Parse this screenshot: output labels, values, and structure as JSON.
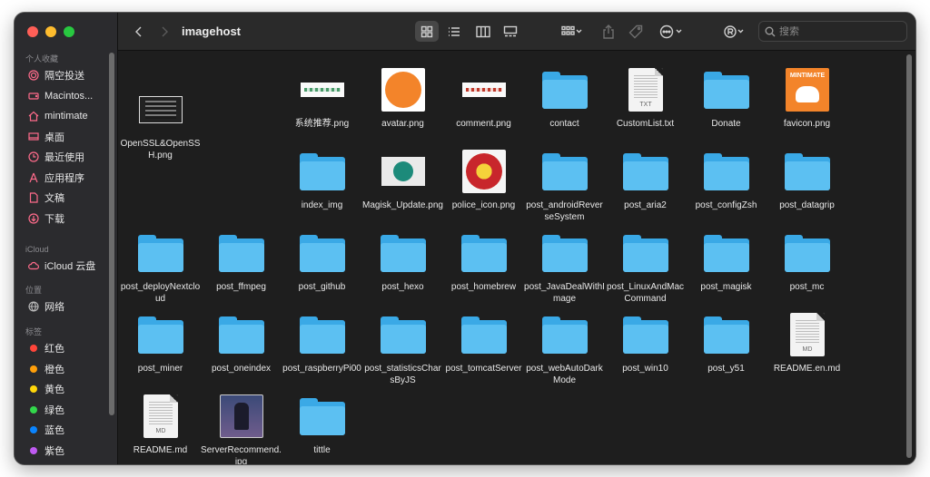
{
  "window": {
    "title": "imagehost"
  },
  "sidebar": {
    "sections": [
      {
        "header": "个人收藏",
        "items": [
          {
            "label": "隔空投送",
            "icon": "airdrop-icon"
          },
          {
            "label": "Macintos...",
            "icon": "harddrive-icon"
          },
          {
            "label": "mintimate",
            "icon": "home-icon"
          },
          {
            "label": "桌面",
            "icon": "desktop-icon"
          },
          {
            "label": "最近使用",
            "icon": "clock-icon"
          },
          {
            "label": "应用程序",
            "icon": "applications-icon"
          },
          {
            "label": "文稿",
            "icon": "document-icon"
          },
          {
            "label": "下载",
            "icon": "download-icon"
          }
        ]
      },
      {
        "header": "iCloud",
        "items": [
          {
            "label": "iCloud 云盘",
            "icon": "cloud-icon"
          }
        ]
      },
      {
        "header": "位置",
        "items": [
          {
            "label": "网络",
            "icon": "network-icon"
          }
        ]
      },
      {
        "header": "标签",
        "items": [
          {
            "label": "红色",
            "color": "#ff453a"
          },
          {
            "label": "橙色",
            "color": "#ff9f0a"
          },
          {
            "label": "黄色",
            "color": "#ffd60a"
          },
          {
            "label": "绿色",
            "color": "#32d74b"
          },
          {
            "label": "蓝色",
            "color": "#0a84ff"
          },
          {
            "label": "紫色",
            "color": "#bf5af2"
          }
        ]
      }
    ]
  },
  "toolbar": {
    "search_placeholder": "搜索",
    "icons": [
      "back-icon",
      "forward-icon",
      "icon-view-icon",
      "list-view-icon",
      "column-view-icon",
      "gallery-view-icon",
      "group-icon",
      "share-icon",
      "tag-icon",
      "more-icon",
      "account-icon",
      "search-icon"
    ]
  },
  "files": [
    {
      "name": "OpenSSL&OpenSSH.png",
      "kind": "thumb-dark"
    },
    {
      "name": "系统推荐.png",
      "kind": "thumb-lines"
    },
    {
      "name": "avatar.png",
      "kind": "thumb-orange-circle"
    },
    {
      "name": "comment.png",
      "kind": "thumb-red"
    },
    {
      "name": "contact",
      "kind": "folder"
    },
    {
      "name": "CustomList.txt",
      "kind": "doc",
      "ext": "TXT"
    },
    {
      "name": "Donate",
      "kind": "folder"
    },
    {
      "name": "favicon.png",
      "kind": "thumb-orange",
      "brand": "MINTIMATE"
    },
    {
      "name": "index_img",
      "kind": "folder"
    },
    {
      "name": "Magisk_Update.png",
      "kind": "thumb-magisk"
    },
    {
      "name": "police_icon.png",
      "kind": "thumb-police"
    },
    {
      "name": "post_androidReverseSystem",
      "kind": "folder"
    },
    {
      "name": "post_aria2",
      "kind": "folder"
    },
    {
      "name": "post_configZsh",
      "kind": "folder"
    },
    {
      "name": "post_datagrip",
      "kind": "folder"
    },
    {
      "name": "post_deployNextcloud",
      "kind": "folder"
    },
    {
      "name": "post_ffmpeg",
      "kind": "folder"
    },
    {
      "name": "post_github",
      "kind": "folder"
    },
    {
      "name": "post_hexo",
      "kind": "folder"
    },
    {
      "name": "post_homebrew",
      "kind": "folder"
    },
    {
      "name": "post_JavaDealWithImage",
      "kind": "folder"
    },
    {
      "name": "post_LinuxAndMacCommand",
      "kind": "folder"
    },
    {
      "name": "post_magisk",
      "kind": "folder"
    },
    {
      "name": "post_mc",
      "kind": "folder"
    },
    {
      "name": "post_miner",
      "kind": "folder"
    },
    {
      "name": "post_oneindex",
      "kind": "folder"
    },
    {
      "name": "post_raspberryPi00",
      "kind": "folder"
    },
    {
      "name": "post_statisticsCharsByJS",
      "kind": "folder"
    },
    {
      "name": "post_tomcatServer",
      "kind": "folder"
    },
    {
      "name": "post_webAutoDarkMode",
      "kind": "folder"
    },
    {
      "name": "post_win10",
      "kind": "folder"
    },
    {
      "name": "post_y51",
      "kind": "folder"
    },
    {
      "name": "README.en.md",
      "kind": "doc",
      "ext": "MD"
    },
    {
      "name": "README.md",
      "kind": "doc",
      "ext": "MD"
    },
    {
      "name": "ServerRecommend.jpg",
      "kind": "thumb-game"
    },
    {
      "name": "tittle",
      "kind": "folder"
    }
  ]
}
